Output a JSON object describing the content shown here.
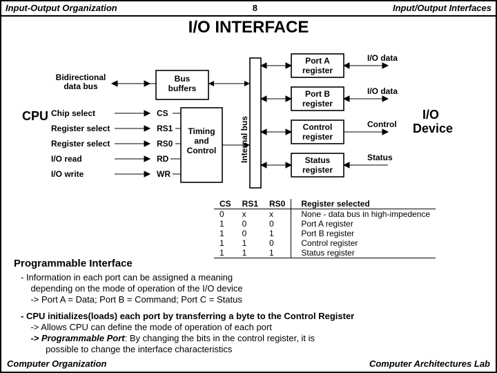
{
  "header": {
    "left": "Input-Output Organization",
    "mid": "8",
    "right": "Input/Output Interfaces"
  },
  "title": "I/O  INTERFACE",
  "diag": {
    "cpu": "CPU",
    "bidir1": "Bidirectional",
    "bidir2": "data bus",
    "sig": [
      "Chip select",
      "Register select",
      "Register select",
      "I/O read",
      "I/O write"
    ],
    "pins": [
      "CS",
      "RS1",
      "RS0",
      "RD",
      "WR"
    ],
    "bus": "Bus",
    "buf": "buffers",
    "tac1": "Timing",
    "tac2": "and",
    "tac3": "Control",
    "ibus": "Internal bus",
    "regs": [
      "Port A",
      "register",
      "Port B",
      "register",
      "Control",
      "register",
      "Status",
      "register"
    ],
    "outs": [
      "I/O data",
      "I/O data",
      "Control",
      "Status"
    ],
    "iod1": "I/O",
    "iod2": "Device"
  },
  "table": {
    "h": [
      "CS",
      "RS1",
      "RS0",
      "Register selected"
    ],
    "rows": [
      [
        "0",
        "x",
        "x",
        "None - data bus in high-impedence"
      ],
      [
        "1",
        "0",
        "0",
        "Port A register"
      ],
      [
        "1",
        "0",
        "1",
        "Port B register"
      ],
      [
        "1",
        "1",
        "0",
        "Control register"
      ],
      [
        "1",
        "1",
        "1",
        "Status register"
      ]
    ]
  },
  "prog": {
    "h": "Programmable Interface",
    "p1": "- Information in each port can be assigned a meaning",
    "p1b": "depending on the mode of operation of the I/O device",
    "p1c": "-> Port A = Data;  Port B = Command;  Port C = Status",
    "p2": "- CPU initializes(loads) each port by transferring a byte to the Control Register",
    "p2b": "-> Allows CPU can define the mode of operation of each port",
    "p2c_em": "-> Programmable Port",
    "p2c": ": By changing the bits in the control register, it is",
    "p2d": "possible to change the interface characteristics"
  },
  "footer": {
    "left": "Computer Organization",
    "right": "Computer Architectures Lab"
  }
}
